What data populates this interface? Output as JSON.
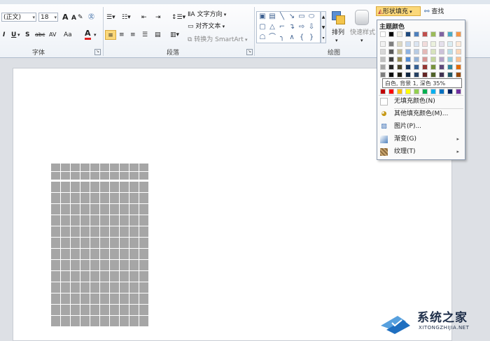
{
  "ribbon": {
    "font_group": {
      "label": "字体",
      "font_name": "(正文)",
      "font_size": "18",
      "grow_font": "A",
      "shrink_font": "A",
      "clear_format": "Aa",
      "phonetic": "A",
      "italic": "I",
      "underline": "U",
      "strikethrough": "abc",
      "char_spacing": "AV",
      "change_case": "Aa",
      "font_color": "A",
      "font_color_hex": "#e02020"
    },
    "paragraph_group": {
      "label": "段落",
      "text_direction": "文字方向",
      "align_text": "对齐文本",
      "convert_smartart": "转换为 SmartArt"
    },
    "drawing_group": {
      "label": "绘图",
      "arrange": "排列",
      "quick_styles": "快速样式",
      "shape_fill": "形状填充",
      "find": "查找"
    }
  },
  "dropdown": {
    "theme_colors_title": "主题颜色",
    "theme_top_row": [
      "#ffffff",
      "#000000",
      "#eeece1",
      "#1f497d",
      "#4f81bd",
      "#c0504d",
      "#9bbb59",
      "#8064a2",
      "#4bacc6",
      "#f79646"
    ],
    "theme_shades": [
      [
        "#f2f2f2",
        "#7f7f7f",
        "#ddd9c3",
        "#c6d9f0",
        "#dbe5f1",
        "#f2dcdb",
        "#ebf1dd",
        "#e5e0ec",
        "#dbeef3",
        "#fdeada"
      ],
      [
        "#d8d8d8",
        "#595959",
        "#c4bd97",
        "#8db3e2",
        "#b8cce4",
        "#e5b9b7",
        "#d7e3bc",
        "#ccc1d9",
        "#b7dde8",
        "#fbd5b5"
      ],
      [
        "#bfbfbf",
        "#3f3f3f",
        "#938953",
        "#548dd4",
        "#95b3d7",
        "#d99694",
        "#c3d69b",
        "#b2a2c7",
        "#92cddc",
        "#fac08f"
      ],
      [
        "#a5a5a5",
        "#262626",
        "#494429",
        "#17365d",
        "#366092",
        "#953734",
        "#76923c",
        "#5f497a",
        "#31859b",
        "#e36c09"
      ],
      [
        "#7f7f7f",
        "#0c0c0c",
        "#1d1b10",
        "#0f243e",
        "#244061",
        "#632423",
        "#4f6128",
        "#3f3151",
        "#205867",
        "#974806"
      ]
    ],
    "standard_colors": [
      "#c00000",
      "#ff0000",
      "#ffc000",
      "#ffff00",
      "#92d050",
      "#00b050",
      "#00b0f0",
      "#0070c0",
      "#002060",
      "#7030a0"
    ],
    "tooltip": "白色, 背景 1, 深色 35%",
    "no_fill": "无填充颜色(N)",
    "more_fill_colors": "其他填充颜色(M)...",
    "picture": "图片(P)...",
    "gradient": "渐变(G)",
    "texture": "纹理(T)"
  },
  "watermark": {
    "name": "系统之家",
    "url": "XITONGZHIJIA.NET"
  }
}
